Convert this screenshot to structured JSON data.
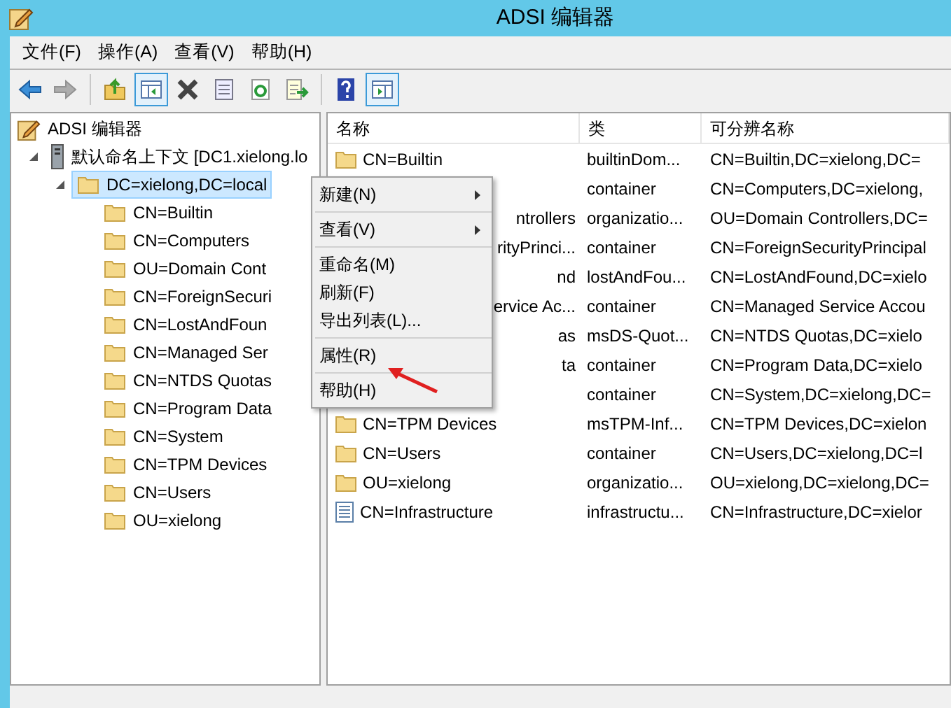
{
  "window": {
    "title": "ADSI 编辑器"
  },
  "menu_bar": [
    "文件(F)",
    "操作(A)",
    "查看(V)",
    "帮助(H)"
  ],
  "toolbar": [
    {
      "kind": "back",
      "disabled": false,
      "on": false
    },
    {
      "kind": "forward",
      "disabled": true,
      "on": false
    },
    {
      "kind": "separator"
    },
    {
      "kind": "up",
      "disabled": false,
      "on": false
    },
    {
      "kind": "tree",
      "disabled": false,
      "on": true
    },
    {
      "kind": "delete",
      "disabled": false,
      "on": false
    },
    {
      "kind": "properties",
      "disabled": false,
      "on": false
    },
    {
      "kind": "refresh",
      "disabled": false,
      "on": false
    },
    {
      "kind": "export",
      "disabled": false,
      "on": false
    },
    {
      "kind": "separator"
    },
    {
      "kind": "help",
      "disabled": false,
      "on": false
    },
    {
      "kind": "actionpane",
      "disabled": false,
      "on": true
    }
  ],
  "tree": {
    "label": "ADSI 编辑器",
    "children": [
      {
        "label": "默认命名上下文 [DC1.xielong.lo",
        "kind": "server",
        "expanded": true,
        "selected": false,
        "children": [
          {
            "label": "DC=xielong,DC=local",
            "kind": "folder",
            "expanded": true,
            "selected": true,
            "children": [
              {
                "label": "CN=Builtin",
                "kind": "folder",
                "selected": false
              },
              {
                "label": "CN=Computers",
                "kind": "folder",
                "selected": false
              },
              {
                "label": "OU=Domain Cont",
                "kind": "folder",
                "selected": false
              },
              {
                "label": "CN=ForeignSecuri",
                "kind": "folder",
                "selected": false
              },
              {
                "label": "CN=LostAndFoun",
                "kind": "folder",
                "selected": false
              },
              {
                "label": "CN=Managed Ser",
                "kind": "folder",
                "selected": false
              },
              {
                "label": "CN=NTDS Quotas",
                "kind": "folder",
                "selected": false
              },
              {
                "label": "CN=Program Data",
                "kind": "folder",
                "selected": false
              },
              {
                "label": "CN=System",
                "kind": "folder",
                "selected": false
              },
              {
                "label": "CN=TPM Devices",
                "kind": "folder",
                "selected": false
              },
              {
                "label": "CN=Users",
                "kind": "folder",
                "selected": false
              },
              {
                "label": "OU=xielong",
                "kind": "folder",
                "selected": false
              }
            ]
          }
        ]
      }
    ]
  },
  "table": {
    "columns": [
      "名称",
      "类",
      "可分辨名称"
    ],
    "rows": [
      {
        "kind": "folder",
        "name": "CN=Builtin",
        "class": "builtinDom...",
        "dn": "CN=Builtin,DC=xielong,DC="
      },
      {
        "kind": "covered",
        "class": "container",
        "dn": "CN=Computers,DC=xielong,"
      },
      {
        "kind": "covered",
        "name": "ntrollers",
        "class": "organizatio...",
        "dn": "OU=Domain Controllers,DC="
      },
      {
        "kind": "covered",
        "name": "rityPrinci...",
        "class": "container",
        "dn": "CN=ForeignSecurityPrincipal"
      },
      {
        "kind": "covered",
        "name": "nd",
        "class": "lostAndFou...",
        "dn": "CN=LostAndFound,DC=xielo"
      },
      {
        "kind": "covered",
        "name": "ervice Ac...",
        "class": "container",
        "dn": "CN=Managed Service Accou"
      },
      {
        "kind": "covered",
        "name": "as",
        "class": "msDS-Quot...",
        "dn": "CN=NTDS Quotas,DC=xielo"
      },
      {
        "kind": "covered",
        "name": "ta",
        "class": "container",
        "dn": "CN=Program Data,DC=xielo"
      },
      {
        "kind": "covered",
        "class": "container",
        "dn": "CN=System,DC=xielong,DC="
      },
      {
        "kind": "folder",
        "name": "CN=TPM Devices",
        "class": "msTPM-Inf...",
        "dn": "CN=TPM Devices,DC=xielon"
      },
      {
        "kind": "folder",
        "name": "CN=Users",
        "class": "container",
        "dn": "CN=Users,DC=xielong,DC=l"
      },
      {
        "kind": "folder",
        "name": "OU=xielong",
        "class": "organizatio...",
        "dn": "OU=xielong,DC=xielong,DC="
      },
      {
        "kind": "document",
        "name": "CN=Infrastructure",
        "class": "infrastructu...",
        "dn": "CN=Infrastructure,DC=xielor"
      }
    ]
  },
  "context_menu": [
    {
      "label": "新建(N)",
      "kind": "submenu"
    },
    {
      "kind": "separator"
    },
    {
      "label": "查看(V)",
      "kind": "submenu"
    },
    {
      "kind": "separator"
    },
    {
      "label": "重命名(M)",
      "kind": "item"
    },
    {
      "label": "刷新(F)",
      "kind": "item"
    },
    {
      "label": "导出列表(L)...",
      "kind": "item"
    },
    {
      "kind": "separator"
    },
    {
      "label": "属性(R)",
      "kind": "item"
    },
    {
      "kind": "separator"
    },
    {
      "label": "帮助(H)",
      "kind": "item"
    }
  ]
}
